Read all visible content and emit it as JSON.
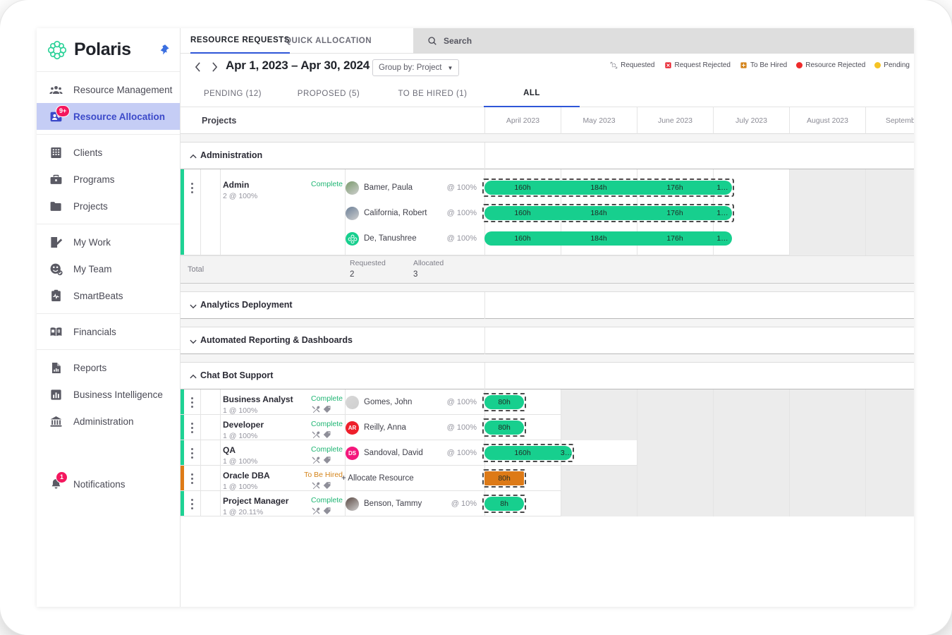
{
  "app": {
    "brand": "Polaris",
    "pin_icon": "pin-icon"
  },
  "sidebar": {
    "groups": [
      {
        "items": [
          {
            "label": "Resource Management",
            "icon": "people-group-icon",
            "active": false,
            "badge": null
          },
          {
            "label": "Resource Allocation",
            "icon": "resource-allocation-icon",
            "active": true,
            "badge": "9+"
          }
        ]
      },
      {
        "items": [
          {
            "label": "Clients",
            "icon": "building-icon",
            "active": false,
            "badge": null
          },
          {
            "label": "Programs",
            "icon": "briefcase-icon",
            "active": false,
            "badge": null
          },
          {
            "label": "Projects",
            "icon": "folder-icon",
            "active": false,
            "badge": null
          }
        ]
      },
      {
        "items": [
          {
            "label": "My Work",
            "icon": "clipboard-edit-icon",
            "active": false,
            "badge": null
          },
          {
            "label": "My Team",
            "icon": "team-check-icon",
            "active": false,
            "badge": null
          },
          {
            "label": "SmartBeats",
            "icon": "pulse-clipboard-icon",
            "active": false,
            "badge": null
          }
        ]
      },
      {
        "items": [
          {
            "label": "Financials",
            "icon": "book-money-icon",
            "active": false,
            "badge": null
          }
        ]
      },
      {
        "items": [
          {
            "label": "Reports",
            "icon": "report-page-icon",
            "active": false,
            "badge": null
          },
          {
            "label": "Business Intelligence",
            "icon": "bar-chart-icon",
            "active": false,
            "badge": null
          },
          {
            "label": "Administration",
            "icon": "bank-icon",
            "active": false,
            "badge": null
          }
        ]
      }
    ],
    "notifications": {
      "label": "Notifications",
      "icon": "bell-icon",
      "badge": "1"
    }
  },
  "topbar": {
    "tabs": [
      {
        "label": "RESOURCE REQUESTS",
        "selected": true
      },
      {
        "label": "QUICK ALLOCATION",
        "selected": false
      }
    ],
    "search_placeholder": "Search",
    "search_value": "",
    "search_icon": "search-icon"
  },
  "daterow": {
    "prev_icon": "chevron-left-icon",
    "next_icon": "chevron-right-icon",
    "range": "Apr 1, 2023 – Apr 30, 2024",
    "group_by_label": "Group by: Project",
    "group_by_caret": "chevron-down-icon"
  },
  "legend": [
    {
      "label": "Requested",
      "icon": "requested-icon",
      "color": "#9a9aa2"
    },
    {
      "label": "Request Rejected",
      "icon": "request-rejected-icon",
      "color": "#e8222f"
    },
    {
      "label": "To Be Hired",
      "icon": "to-be-hired-icon",
      "color": "#d4841b"
    },
    {
      "label": "Resource Rejected",
      "icon": "dot-icon",
      "color": "#ee2b2b"
    },
    {
      "label": "Pending",
      "icon": "dot-icon",
      "color": "#f5c324"
    }
  ],
  "status_tabs": [
    {
      "label": "PENDING (12)",
      "selected": false
    },
    {
      "label": "PROPOSED (5)",
      "selected": false
    },
    {
      "label": "TO BE HIRED (1)",
      "selected": false
    },
    {
      "label": "ALL",
      "selected": true
    }
  ],
  "grid": {
    "left_header": "Projects",
    "months": [
      "April 2023",
      "May 2023",
      "June 2023",
      "July 2023",
      "August 2023",
      "September"
    ],
    "total_row": {
      "label": "Total",
      "requested_label": "Requested",
      "requested_value": "2",
      "allocated_label": "Allocated",
      "allocated_value": "3"
    }
  },
  "groups": [
    {
      "name": "Administration",
      "expanded": true,
      "chevron": "chevron-up-icon",
      "requests": [
        {
          "role": "Admin",
          "sub": "2 @ 100%",
          "status": "Complete",
          "status_type": "complete",
          "accent": "#1ed294",
          "tools": false,
          "resources": [
            {
              "name": "Bamer, Paula",
              "pct": "@ 100%",
              "avatar_type": "photo",
              "avatar_color": "#7a9a6c",
              "initials": "",
              "bar": {
                "style": "dashed-filled",
                "color": "#17cf8e",
                "start_month": 0,
                "span": 3.25,
                "segments": [
                  "160h",
                  "184h",
                  "176h",
                  "1…"
                ]
              }
            },
            {
              "name": "California, Robert",
              "pct": "@ 100%",
              "avatar_type": "photo",
              "avatar_color": "#6b7f97",
              "initials": "",
              "bar": {
                "style": "dashed-filled",
                "color": "#17cf8e",
                "start_month": 0,
                "span": 3.25,
                "segments": [
                  "160h",
                  "184h",
                  "176h",
                  "1…"
                ]
              }
            },
            {
              "name": "De, Tanushree",
              "pct": "@ 100%",
              "avatar_type": "logo",
              "avatar_color": "#17cf8e",
              "initials": "",
              "bar": {
                "style": "filled",
                "color": "#17cf8e",
                "start_month": 0,
                "span": 3.25,
                "segments": [
                  "160h",
                  "184h",
                  "176h",
                  "1…"
                ]
              }
            }
          ]
        }
      ],
      "show_total": true
    },
    {
      "name": "Analytics Deployment",
      "expanded": false,
      "chevron": "chevron-down-icon",
      "requests": [],
      "show_total": false
    },
    {
      "name": "Automated Reporting & Dashboards",
      "expanded": false,
      "chevron": "chevron-down-icon",
      "requests": [],
      "show_total": false
    },
    {
      "name": "Chat Bot Support",
      "expanded": true,
      "chevron": "chevron-up-icon",
      "requests": [
        {
          "role": "Business Analyst",
          "sub": "1 @ 100%",
          "status": "Complete",
          "status_type": "complete",
          "accent": "#1ed294",
          "tools": true,
          "resources": [
            {
              "name": "Gomes, John",
              "pct": "@ 100%",
              "avatar_type": "photo",
              "avatar_color": "#d8d8d8",
              "initials": "",
              "bar": {
                "style": "dashed-filled",
                "color": "#17cf8e",
                "start_month": 0,
                "span": 0.52,
                "segments": [
                  "80h"
                ]
              }
            }
          ]
        },
        {
          "role": "Developer",
          "sub": "1 @ 100%",
          "status": "Complete",
          "status_type": "complete",
          "accent": "#1ed294",
          "tools": true,
          "resources": [
            {
              "name": "Reilly, Anna",
              "pct": "@ 100%",
              "avatar_type": "initials",
              "avatar_color": "#ee1f2b",
              "initials": "AR",
              "bar": {
                "style": "dashed-filled",
                "color": "#17cf8e",
                "start_month": 0,
                "span": 0.52,
                "segments": [
                  "80h"
                ]
              }
            }
          ]
        },
        {
          "role": "QA",
          "sub": "1 @ 100%",
          "status": "Complete",
          "status_type": "complete",
          "accent": "#1ed294",
          "tools": true,
          "resources": [
            {
              "name": "Sandoval, David",
              "pct": "@ 100%",
              "avatar_type": "initials",
              "avatar_color": "#f4187c",
              "initials": "DS",
              "bar": {
                "style": "dashed-filled",
                "color": "#17cf8e",
                "start_month": 0,
                "span": 1.15,
                "segments": [
                  "160h",
                  "3…"
                ]
              }
            }
          ]
        },
        {
          "role": "Oracle DBA",
          "sub": "1 @ 100%",
          "status": "To Be Hired",
          "status_type": "tobehired",
          "accent": "#dd7a17",
          "tools": true,
          "resources": [
            {
              "name": "+ Allocate Resource",
              "pct": "",
              "avatar_type": "none",
              "avatar_color": "",
              "initials": "",
              "bar": {
                "style": "dashed-filled",
                "color": "#dd7a17",
                "start_month": 0,
                "span": 0.52,
                "segments": [
                  "80h"
                ],
                "square": true
              }
            }
          ]
        },
        {
          "role": "Project Manager",
          "sub": "1 @ 20.11%",
          "status": "Complete",
          "status_type": "complete",
          "accent": "#1ed294",
          "tools": true,
          "resources": [
            {
              "name": "Benson, Tammy",
              "pct": "@ 10%",
              "avatar_type": "photo",
              "avatar_color": "#5b4a44",
              "initials": "",
              "bar": {
                "style": "dashed-filled",
                "color": "#17cf8e",
                "start_month": 0,
                "span": 0.52,
                "segments": [
                  "8h"
                ]
              }
            }
          ]
        }
      ],
      "show_total": false
    }
  ]
}
